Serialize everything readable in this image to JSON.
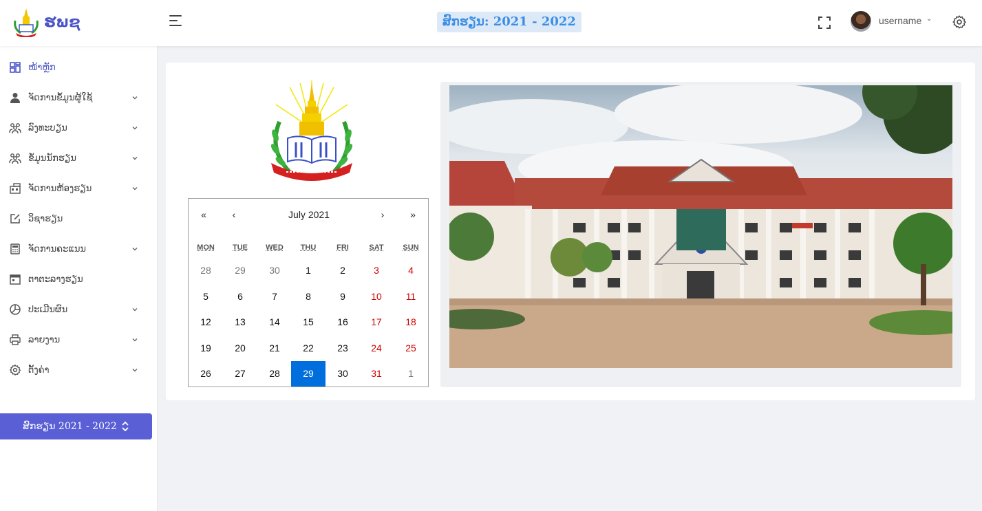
{
  "header": {
    "brand": "ຮພຊ",
    "year_badge": "ສົກຮຽນ: 2021 - 2022",
    "username": "username"
  },
  "sidebar": {
    "items": [
      {
        "label": "ໜ້າຫຼັກ",
        "icon": "dashboard-icon",
        "has_children": false,
        "active": true
      },
      {
        "label": "ຈັດການຂໍ້ມູນຜູ້ໃຊ້",
        "icon": "user-icon",
        "has_children": true
      },
      {
        "label": "ລົງທະບຽນ",
        "icon": "users-icon",
        "has_children": true
      },
      {
        "label": "ຂໍ້ມູນນັກຮຽນ",
        "icon": "students-icon",
        "has_children": true
      },
      {
        "label": "ຈັດການຫ້ອງຮຽນ",
        "icon": "classroom-icon",
        "has_children": true
      },
      {
        "label": "ວິຊາຮຽນ",
        "icon": "edit-icon",
        "has_children": false
      },
      {
        "label": "ຈັດການຄະແນນ",
        "icon": "calculator-icon",
        "has_children": true
      },
      {
        "label": "ຕາຕະລາງຮຽນ",
        "icon": "calendar-icon",
        "has_children": false
      },
      {
        "label": "ປະເມີນຜົນ",
        "icon": "pie-chart-icon",
        "has_children": true
      },
      {
        "label": "ລາຍງານ",
        "icon": "printer-icon",
        "has_children": true
      },
      {
        "label": "ຕັ້ງຄ່າ",
        "icon": "settings-icon",
        "has_children": true
      }
    ],
    "year_select": "ສົກຮຽນ 2021 - 2022"
  },
  "calendar": {
    "title": "July 2021",
    "nav": {
      "prev_year": "«",
      "prev_month": "‹",
      "next_month": "›",
      "next_year": "»"
    },
    "weekdays": [
      "MON",
      "TUE",
      "WED",
      "THU",
      "FRI",
      "SAT",
      "SUN"
    ],
    "weeks": [
      [
        "28",
        "29",
        "30",
        "1",
        "2",
        "3",
        "4"
      ],
      [
        "5",
        "6",
        "7",
        "8",
        "9",
        "10",
        "11"
      ],
      [
        "12",
        "13",
        "14",
        "15",
        "16",
        "17",
        "18"
      ],
      [
        "19",
        "20",
        "21",
        "22",
        "23",
        "24",
        "25"
      ],
      [
        "26",
        "27",
        "28",
        "29",
        "30",
        "31",
        "1"
      ]
    ],
    "outside_month": [
      [
        0,
        0
      ],
      [
        0,
        1
      ],
      [
        0,
        2
      ],
      [
        4,
        6
      ]
    ],
    "selected": [
      4,
      3
    ],
    "colors": {
      "selected": "#006edc",
      "weekend": "#d10000"
    }
  },
  "colors": {
    "accent": "#4a55c7",
    "year_button": "#5a5fd6",
    "badge_bg": "#dde9f7",
    "badge_text": "#3b8ee6"
  }
}
